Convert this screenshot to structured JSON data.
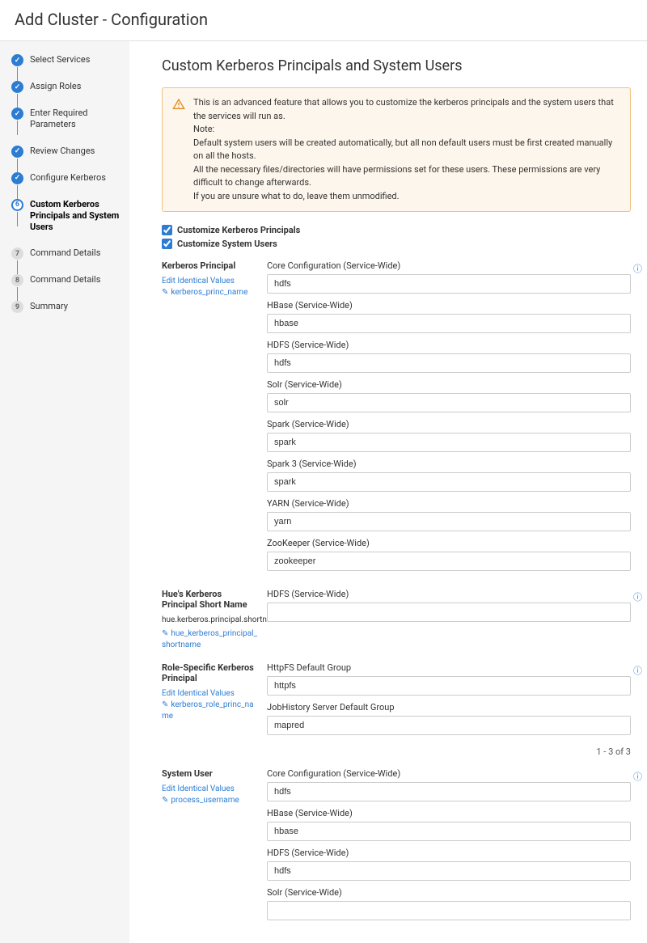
{
  "header": {
    "title": "Add Cluster - Configuration"
  },
  "sidebar": {
    "steps": [
      {
        "label": "Select Services",
        "state": "done",
        "num": ""
      },
      {
        "label": "Assign Roles",
        "state": "done",
        "num": ""
      },
      {
        "label": "Enter Required Parameters",
        "state": "done",
        "num": ""
      },
      {
        "label": "Review Changes",
        "state": "done",
        "num": ""
      },
      {
        "label": "Configure Kerberos",
        "state": "done",
        "num": ""
      },
      {
        "label": "Custom Kerberos Principals and System Users",
        "state": "current",
        "num": "6"
      },
      {
        "label": "Command Details",
        "state": "pending",
        "num": "7"
      },
      {
        "label": "Command Details",
        "state": "pending",
        "num": "8"
      },
      {
        "label": "Summary",
        "state": "pending",
        "num": "9"
      }
    ]
  },
  "main": {
    "title": "Custom Kerberos Principals and System Users",
    "alert": {
      "l1": "This is an advanced feature that allows you to customize the kerberos principals and the system users that the services will run as.",
      "l2": "Note:",
      "l3": "Default system users will be created automatically, but all non default users must be first created manually on all the hosts.",
      "l4": "All the necessary files/directories will have permissions set for these users. These permissions are very difficult to change afterwards.",
      "l5": "If you are unsure what to do, leave them unmodified."
    },
    "checks": {
      "c1": "Customize Kerberos Principals",
      "c2": "Customize System Users"
    },
    "sections": [
      {
        "title": "Kerberos Principal",
        "edit": "Edit Identical Values",
        "prop": "kerberos_princ_name",
        "fields": [
          {
            "label": "Core Configuration (Service-Wide)",
            "value": "hdfs"
          },
          {
            "label": "HBase (Service-Wide)",
            "value": "hbase"
          },
          {
            "label": "HDFS (Service-Wide)",
            "value": "hdfs"
          },
          {
            "label": "Solr (Service-Wide)",
            "value": "solr"
          },
          {
            "label": "Spark (Service-Wide)",
            "value": "spark"
          },
          {
            "label": "Spark 3 (Service-Wide)",
            "value": "spark"
          },
          {
            "label": "YARN (Service-Wide)",
            "value": "yarn"
          },
          {
            "label": "ZooKeeper (Service-Wide)",
            "value": "zookeeper"
          }
        ]
      },
      {
        "title": "Hue's Kerberos Principal Short Name",
        "sub": "hue.kerberos.principal.shortname",
        "prop": "hue_kerberos_principal_shortname",
        "fields": [
          {
            "label": "HDFS (Service-Wide)",
            "value": ""
          }
        ]
      },
      {
        "title": "Role-Specific Kerberos Principal",
        "edit": "Edit Identical Values",
        "prop": "kerberos_role_princ_name",
        "fields": [
          {
            "label": "HttpFS Default Group",
            "value": "httpfs"
          },
          {
            "label": "JobHistory Server Default Group",
            "value": "mapred"
          }
        ]
      },
      {
        "title": "System User",
        "edit": "Edit Identical Values",
        "prop": "process_username",
        "fields": [
          {
            "label": "Core Configuration (Service-Wide)",
            "value": "hdfs"
          },
          {
            "label": "HBase (Service-Wide)",
            "value": "hbase"
          },
          {
            "label": "HDFS (Service-Wide)",
            "value": "hdfs"
          },
          {
            "label": "Solr (Service-Wide)",
            "value": ""
          }
        ]
      }
    ],
    "pager": "1 - 3 of 3"
  }
}
